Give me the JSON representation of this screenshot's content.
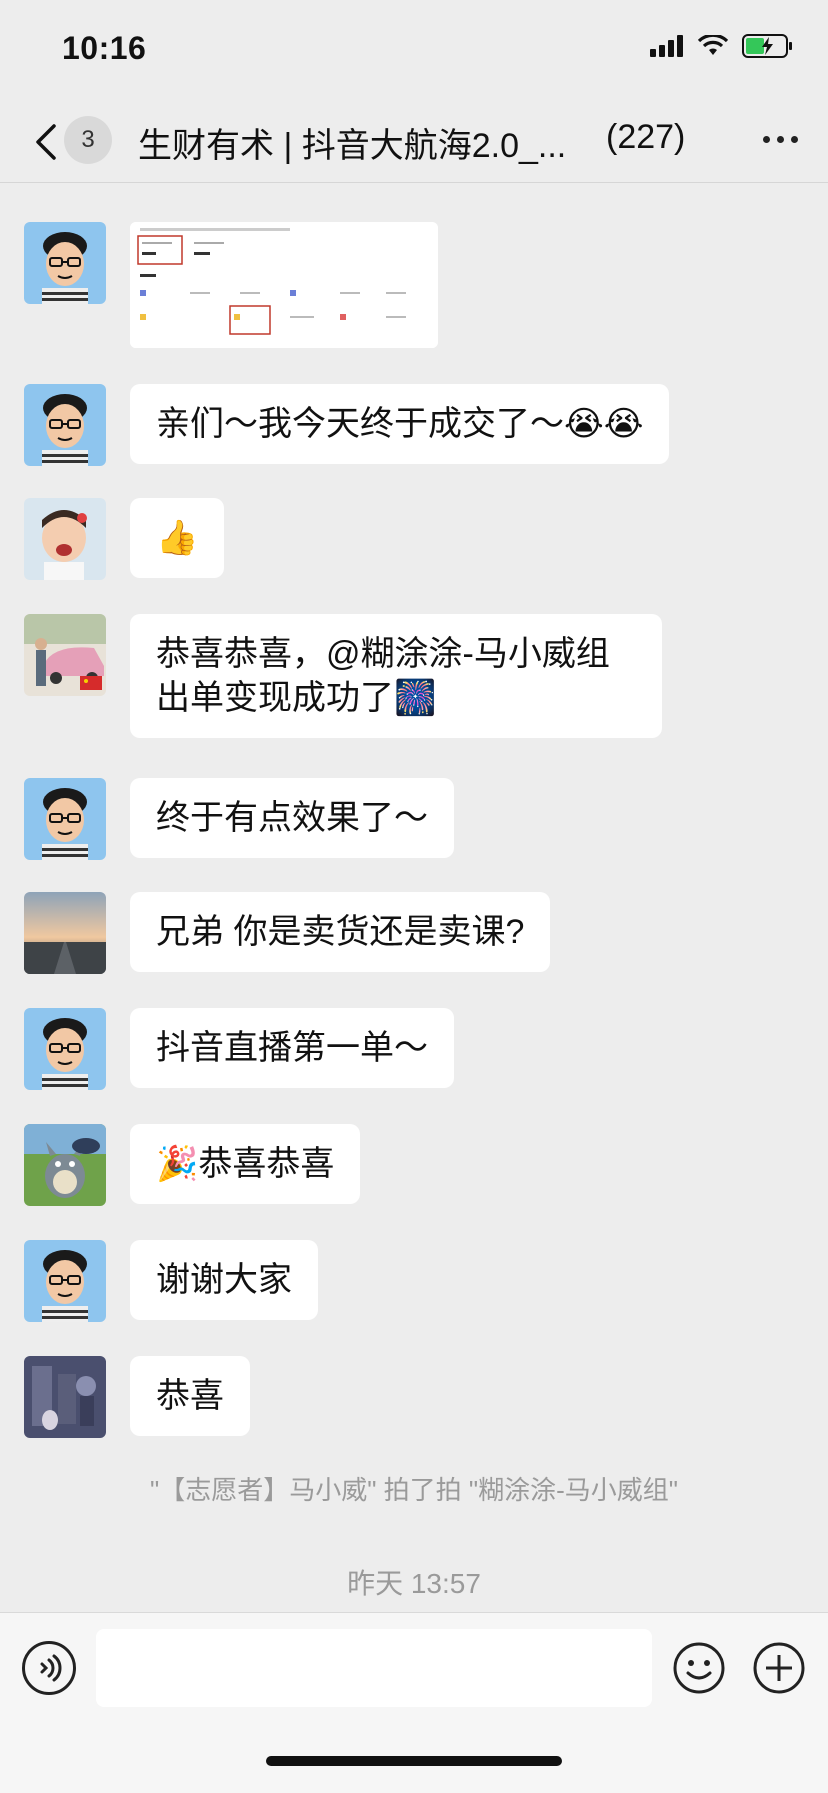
{
  "status_bar": {
    "time": "10:16",
    "icons": [
      "signal-icon",
      "wifi-icon",
      "battery-charging-icon"
    ]
  },
  "nav": {
    "unread_count": "3",
    "title": "生财有术 | 抖音大航海2.0_...",
    "member_count": "(227)",
    "icons": [
      "back-icon",
      "more-icon"
    ]
  },
  "messages": [
    {
      "avatar": "cartoon-glasses-avatar",
      "type": "image",
      "image_desc": "dashboard-screenshot"
    },
    {
      "avatar": "cartoon-glasses-avatar",
      "text": "亲们～我今天终于成交了～😭😭"
    },
    {
      "avatar": "child-photo-avatar",
      "text": "👍"
    },
    {
      "avatar": "car-photo-avatar",
      "text": "恭喜恭喜，@糊涂涂-马小威组 出单变现成功了🎆"
    },
    {
      "avatar": "cartoon-glasses-avatar",
      "text": "终于有点效果了～"
    },
    {
      "avatar": "sunset-road-avatar",
      "text": "兄弟  你是卖货还是卖课?"
    },
    {
      "avatar": "cartoon-glasses-avatar",
      "text": "抖音直播第一单～"
    },
    {
      "avatar": "totoro-avatar",
      "text": "🎉恭喜恭喜"
    },
    {
      "avatar": "cartoon-glasses-avatar",
      "text": "谢谢大家"
    },
    {
      "avatar": "dark-illustration-avatar",
      "text": "恭喜"
    }
  ],
  "system_note": "\"【志愿者】马小威\" 拍了拍 \"糊涂涂-马小威组\"",
  "timestamp": "昨天 13:57",
  "input": {
    "value": "",
    "icons": [
      "voice-icon",
      "emoji-icon",
      "plus-icon"
    ]
  },
  "colors": {
    "background": "#ededed",
    "bubble": "#ffffff",
    "avatar_blue": "#8ec5ee"
  }
}
